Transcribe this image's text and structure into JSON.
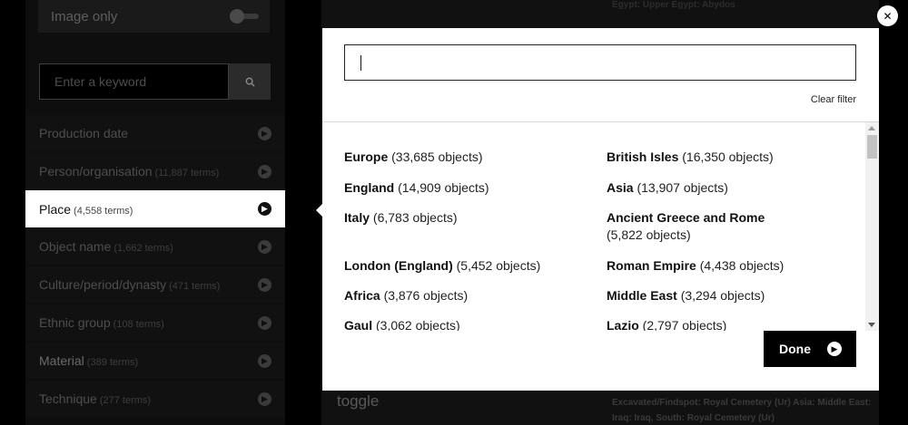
{
  "sidebar": {
    "image_only": {
      "label": "Image only"
    },
    "search": {
      "placeholder": "Enter a keyword"
    },
    "facets": [
      {
        "label": "Production date",
        "count": ""
      },
      {
        "label": "Person/organisation",
        "count": "(11,887 terms)"
      },
      {
        "label": "Place",
        "count": "(4,558 terms)"
      },
      {
        "label": "Object name",
        "count": "(1,662 terms)"
      },
      {
        "label": "Culture/period/dynasty",
        "count": "(471 terms)"
      },
      {
        "label": "Ethnic group",
        "count": "(108 terms)"
      },
      {
        "label": "Material",
        "count": "(389 terms)"
      },
      {
        "label": "Technique",
        "count": "(277 terms)"
      }
    ]
  },
  "background": {
    "top_text": "Egypt: Upper Egypt: Abydos",
    "toggle_text": "toggle",
    "bottom_text": "Excavated/Findspot: Royal Cemetery (Ur) Asia: Middle East: Iraq: Iraq, South: Royal Cemetery (Ur)"
  },
  "modal": {
    "filter_value": "",
    "clear_filter_label": "Clear filter",
    "done_label": "Done",
    "options": [
      {
        "name": "Europe",
        "count": "(33,685 objects)"
      },
      {
        "name": "British Isles",
        "count": "(16,350 objects)"
      },
      {
        "name": "England",
        "count": "(14,909 objects)"
      },
      {
        "name": "Asia",
        "count": "(13,907 objects)"
      },
      {
        "name": "Italy",
        "count": "(6,783 objects)"
      },
      {
        "name": "Ancient Greece and Rome",
        "count": "(5,822 objects)"
      },
      {
        "name": "London (England)",
        "count": "(5,452 objects)"
      },
      {
        "name": "Roman Empire",
        "count": "(4,438 objects)"
      },
      {
        "name": "Africa",
        "count": "(3,876 objects)"
      },
      {
        "name": "Middle East",
        "count": "(3,294 objects)"
      },
      {
        "name": "Gaul",
        "count": "(3,062 objects)"
      },
      {
        "name": "Lazio",
        "count": "(2,797 objects)"
      }
    ]
  },
  "icons": {
    "search": "search-icon",
    "arrow": "arrow-right-icon",
    "close": "close-icon"
  },
  "colors": {
    "background": "#000000",
    "active_facet": "#ffffff",
    "modal": "#ffffff",
    "done_button": "#000000"
  }
}
